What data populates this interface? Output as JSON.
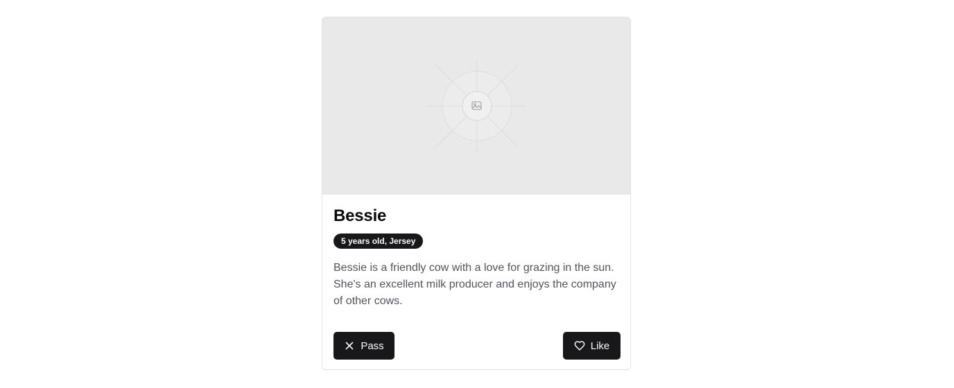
{
  "profile": {
    "name": "Bessie",
    "badge": "5 years old, Jersey",
    "description": "Bessie is a friendly cow with a love for grazing in the sun. She's an excellent milk producer and enjoys the company of other cows.",
    "image_icon": "image-placeholder-icon"
  },
  "actions": {
    "pass_label": "Pass",
    "pass_icon": "close-icon",
    "like_label": "Like",
    "like_icon": "heart-icon"
  },
  "colors": {
    "button_bg": "#18181b",
    "button_text": "#fafafa",
    "placeholder_bg": "#e9e9e9",
    "description_text": "#52525b"
  }
}
